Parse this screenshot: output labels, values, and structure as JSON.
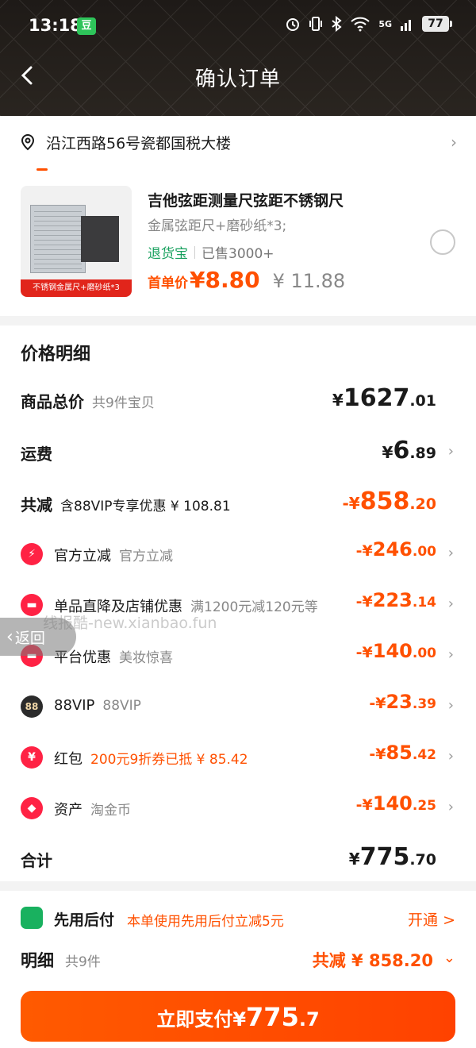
{
  "status": {
    "time": "13:18",
    "badge": "豆",
    "network": "5G",
    "battery": "77"
  },
  "nav": {
    "title": "确认订单"
  },
  "address": {
    "text": "沿江西路56号瓷都国税大楼"
  },
  "product": {
    "image_banner": "不锈钢金属尺+磨砂纸*3",
    "title": "吉他弦距测量尺弦距不锈钢尺",
    "spec": "金属弦距尺+磨砂纸*3;",
    "tag_return": "退货宝",
    "tag_sold": "已售3000+",
    "first_label": "首单价",
    "first_price": "¥8.80",
    "original_price": "¥ 11.88"
  },
  "detail": {
    "title": "价格明细",
    "total_goods": {
      "label": "商品总价",
      "sub": "共9件宝贝",
      "cur": "¥",
      "big": "1627",
      "dec": ".01"
    },
    "shipping": {
      "label": "运费",
      "cur": "¥",
      "big": "6",
      "dec": ".89"
    },
    "discount": {
      "label": "共减",
      "sub": "含88VIP专享优惠 ¥ 108.81",
      "cur": "-¥",
      "big": "858",
      "dec": ".20"
    },
    "items": [
      {
        "label": "官方立减",
        "sub": "官方立减",
        "cur": "-¥",
        "big": "246",
        "dec": ".00",
        "icon": "⚡"
      },
      {
        "label": "单品直降及店铺优惠",
        "sub": "满1200元减120元等",
        "cur": "-¥",
        "big": "223",
        "dec": ".14",
        "icon": "▬"
      },
      {
        "label": "平台优惠",
        "sub": "美妆惊喜",
        "cur": "-¥",
        "big": "140",
        "dec": ".00",
        "icon": "▬"
      },
      {
        "label": "88VIP",
        "sub": "88VIP",
        "cur": "-¥",
        "big": "23",
        "dec": ".39",
        "icon": "88"
      },
      {
        "label": "红包",
        "sub": "200元9折券已抵 ¥ 85.42",
        "cur": "-¥",
        "big": "85",
        "dec": ".42",
        "icon": "¥"
      },
      {
        "label": "资产",
        "sub": "淘金币",
        "cur": "-¥",
        "big": "140",
        "dec": ".25",
        "icon": "◆"
      }
    ],
    "sum": {
      "label": "合计",
      "cur": "¥",
      "big": "775",
      "dec": ".70"
    }
  },
  "paylater": {
    "title": "先用后付",
    "desc": "本单使用先用后付立减5元",
    "open": "开通 >"
  },
  "mingxi": {
    "label": "明细",
    "sub": "共9件",
    "total": "共减 ¥ 858.20",
    "chev": "⌄"
  },
  "pay_button": {
    "label": "立即支付",
    "cur": "¥",
    "big": "775",
    "dec": ".7"
  },
  "overlay": {
    "watermark": "线报酷-new.xianbao.fun",
    "back": "返回"
  }
}
